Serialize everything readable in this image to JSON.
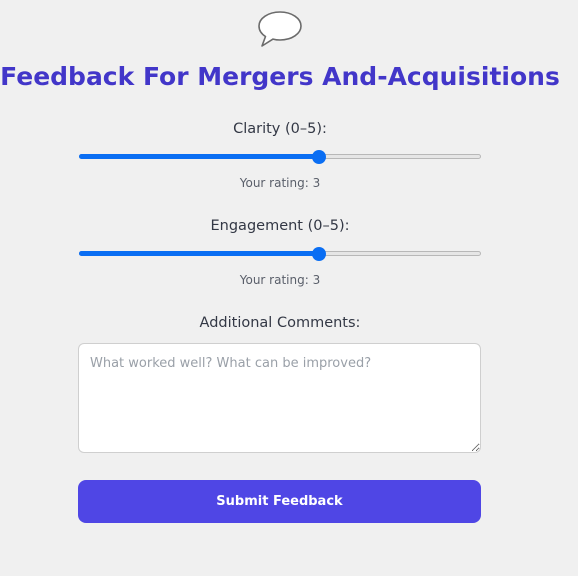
{
  "header": {
    "icon": "speech-bubble-icon",
    "title": "Feedback For Mergers And-Acquisitions"
  },
  "ratings": [
    {
      "label": "Clarity (0–5):",
      "value": 3,
      "min": 0,
      "max": 5,
      "rating_text": "Your rating: 3"
    },
    {
      "label": "Engagement (0–5):",
      "value": 3,
      "min": 0,
      "max": 5,
      "rating_text": "Your rating: 3"
    }
  ],
  "comments": {
    "label": "Additional Comments:",
    "value": "",
    "placeholder": "What worked well? What can be improved?"
  },
  "submit": {
    "label": "Submit Feedback"
  },
  "colors": {
    "title": "#4236c9",
    "slider_accent": "#0a6ef3",
    "button": "#4f46e5",
    "background": "#f0f0f0"
  }
}
